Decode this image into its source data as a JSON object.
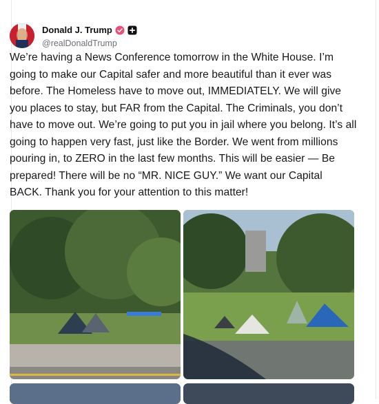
{
  "post": {
    "author_name": "Donald J. Trump",
    "author_handle": "@realDonaldTrump",
    "body": "We’re having a News Conference tomorrow in the White House. I’m going to make our Capital safer and more beautiful than it ever was before. The Homeless have to move out, IMMEDIATELY. We will give you places to stay, but FAR from the Capital. The Criminals, you don’t have to move out. We’re going to put you in jail where you belong. It’s all going to happen very fast, just like the Border. We went from millions pouring in, to ZERO in the last few months. This will be easier — Be prepared! There will be no “MR. NICE GUY.” We want our Capital BACK. Thank you for your attention to this matter!"
  },
  "icons": {
    "verified": "verified-badge-icon",
    "plus": "plus-badge-icon"
  },
  "colors": {
    "verified_badge": "#e8507a",
    "handle_text": "#6b6f76",
    "border": "#e7e7ea"
  }
}
